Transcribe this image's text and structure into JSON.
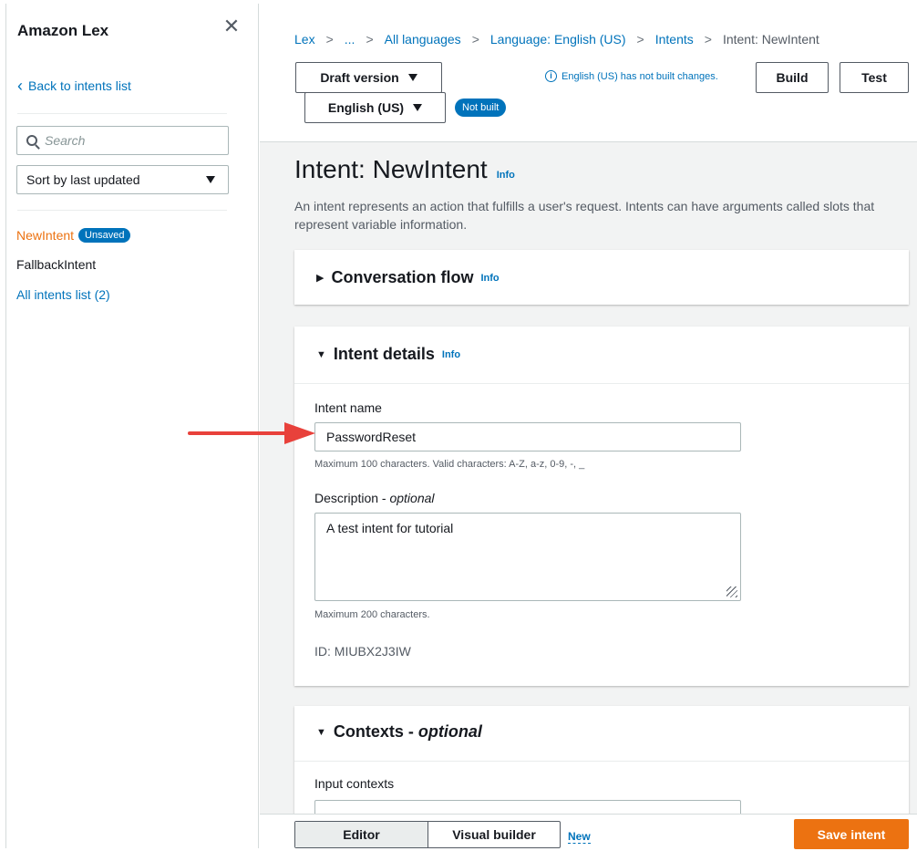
{
  "sidebar": {
    "title": "Amazon Lex",
    "close_icon": "close-icon",
    "back_label": "Back to intents list",
    "search_placeholder": "Search",
    "sort_label": "Sort by last updated",
    "items": [
      {
        "label": "NewIntent",
        "badge": "Unsaved"
      },
      {
        "label": "FallbackIntent"
      },
      {
        "label": "All intents list (2)"
      }
    ]
  },
  "breadcrumb": [
    "Lex",
    "...",
    "All languages",
    "Language: English (US)",
    "Intents",
    "Intent: NewIntent"
  ],
  "toolbar": {
    "version_label": "Draft version",
    "language_label": "English (US)",
    "status_badge": "Not built",
    "build_message": "English (US) has not built changes.",
    "build_label": "Build",
    "test_label": "Test"
  },
  "page": {
    "title": "Intent: NewIntent",
    "info": "Info",
    "description": "An intent represents an action that fulfills a user's request. Intents can have arguments called slots that represent variable information."
  },
  "conversation_flow": {
    "title": "Conversation flow",
    "info": "Info"
  },
  "intent_details": {
    "title": "Intent details",
    "info": "Info",
    "name_label": "Intent name",
    "name_value": "PasswordReset",
    "name_hint": "Maximum 100 characters. Valid characters: A-Z, a-z, 0-9, -, _",
    "desc_label": "Description - ",
    "desc_optional": "optional",
    "desc_value": "A test intent for tutorial",
    "desc_hint": "Maximum 200 characters.",
    "id_text": "ID: MIUBX2J3IW"
  },
  "contexts": {
    "title": "Contexts - ",
    "optional": "optional",
    "input_label": "Input contexts"
  },
  "bottom": {
    "editor_label": "Editor",
    "visual_label": "Visual builder",
    "new_tag": "New",
    "save_label": "Save intent"
  },
  "colors": {
    "accent": "#0073bb",
    "primary_button": "#ec7211",
    "annotation_arrow": "#e8413b"
  }
}
